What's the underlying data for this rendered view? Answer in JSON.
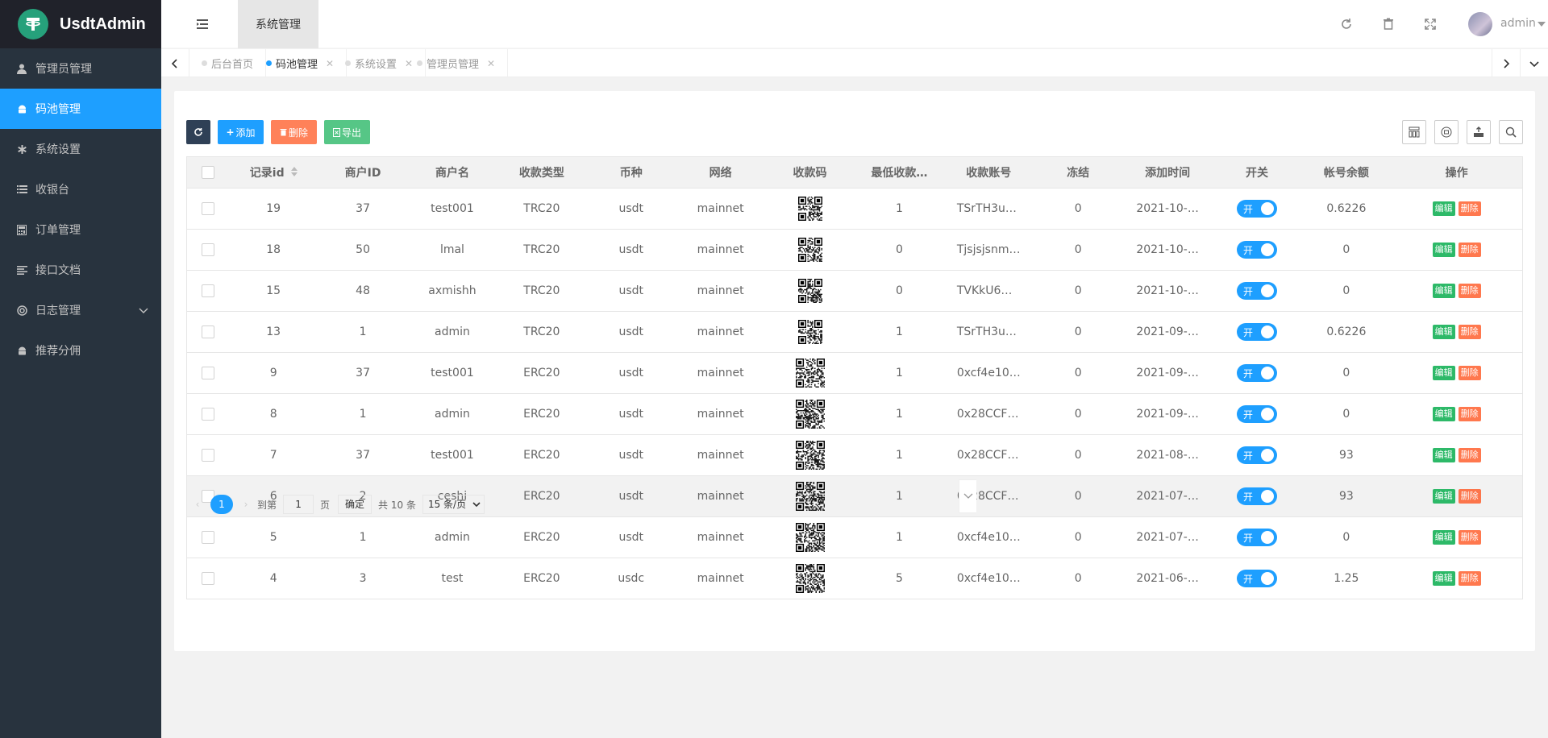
{
  "app": {
    "title": "UsdtAdmin"
  },
  "sidebar": {
    "items": [
      {
        "label": "管理员管理",
        "icon": "user-icon"
      },
      {
        "label": "码池管理",
        "icon": "android-icon",
        "active": true
      },
      {
        "label": "系统设置",
        "icon": "asterisk-icon"
      },
      {
        "label": "收银台",
        "icon": "list-icon"
      },
      {
        "label": "订单管理",
        "icon": "calculator-icon"
      },
      {
        "label": "接口文档",
        "icon": "align-left-icon"
      },
      {
        "label": "日志管理",
        "icon": "life-ring-icon",
        "expandable": true
      },
      {
        "label": "推荐分佣",
        "icon": "android-icon"
      }
    ]
  },
  "header": {
    "top_tab": "系统管理",
    "user": "admin",
    "icons": [
      "refresh-icon",
      "trash-icon",
      "fullscreen-icon"
    ]
  },
  "tabs": [
    {
      "label": "后台首页",
      "closable": false
    },
    {
      "label": "码池管理",
      "closable": true,
      "active": true
    },
    {
      "label": "系统设置",
      "closable": true
    },
    {
      "label": "管理员管理",
      "closable": true
    }
  ],
  "toolbar": {
    "add_label": "添加",
    "delete_label": "删除",
    "export_label": "导出"
  },
  "table": {
    "columns": [
      "记录id",
      "商户ID",
      "商户名",
      "收款类型",
      "币种",
      "网络",
      "收款码",
      "最低收款…",
      "收款账号",
      "冻结",
      "添加时间",
      "开关",
      "帐号余额",
      "操作"
    ],
    "switch_label": "开",
    "edit_label": "编辑",
    "del_label": "删除",
    "rows": [
      {
        "id": "19",
        "mid": "37",
        "mname": "test001",
        "type": "TRC20",
        "coin": "usdt",
        "net": "mainnet",
        "min": "1",
        "addr": "TSrTH3u…",
        "frozen": "0",
        "time": "2021-10-…",
        "balance": "0.6226"
      },
      {
        "id": "18",
        "mid": "50",
        "mname": "lmal",
        "type": "TRC20",
        "coin": "usdt",
        "net": "mainnet",
        "min": "0",
        "addr": "Tjsjsjsnm…",
        "frozen": "0",
        "time": "2021-10-…",
        "balance": "0"
      },
      {
        "id": "15",
        "mid": "48",
        "mname": "axmishh",
        "type": "TRC20",
        "coin": "usdt",
        "net": "mainnet",
        "min": "0",
        "addr": "TVKkU6…",
        "frozen": "0",
        "time": "2021-10-…",
        "balance": "0"
      },
      {
        "id": "13",
        "mid": "1",
        "mname": "admin",
        "type": "TRC20",
        "coin": "usdt",
        "net": "mainnet",
        "min": "1",
        "addr": "TSrTH3u…",
        "frozen": "0",
        "time": "2021-09-…",
        "balance": "0.6226"
      },
      {
        "id": "9",
        "mid": "37",
        "mname": "test001",
        "type": "ERC20",
        "coin": "usdt",
        "net": "mainnet",
        "min": "1",
        "addr": "0xcf4e10…",
        "frozen": "0",
        "time": "2021-09-…",
        "balance": "0"
      },
      {
        "id": "8",
        "mid": "1",
        "mname": "admin",
        "type": "ERC20",
        "coin": "usdt",
        "net": "mainnet",
        "min": "1",
        "addr": "0x28CCF…",
        "frozen": "0",
        "time": "2021-09-…",
        "balance": "0"
      },
      {
        "id": "7",
        "mid": "37",
        "mname": "test001",
        "type": "ERC20",
        "coin": "usdt",
        "net": "mainnet",
        "min": "1",
        "addr": "0x28CCF…",
        "frozen": "0",
        "time": "2021-08-…",
        "balance": "93"
      },
      {
        "id": "6",
        "mid": "2",
        "mname": "ceshi",
        "type": "ERC20",
        "coin": "usdt",
        "net": "mainnet",
        "min": "1",
        "addr": "0x28CCF…",
        "frozen": "0",
        "time": "2021-07-…",
        "balance": "93"
      },
      {
        "id": "5",
        "mid": "1",
        "mname": "admin",
        "type": "ERC20",
        "coin": "usdt",
        "net": "mainnet",
        "min": "1",
        "addr": "0xcf4e10…",
        "frozen": "0",
        "time": "2021-07-…",
        "balance": "0"
      },
      {
        "id": "4",
        "mid": "3",
        "mname": "test",
        "type": "ERC20",
        "coin": "usdc",
        "net": "mainnet",
        "min": "5",
        "addr": "0xcf4e10…",
        "frozen": "0",
        "time": "2021-06-…",
        "balance": "1.25"
      }
    ]
  },
  "pager": {
    "current": "1",
    "goto_prefix": "到第",
    "goto_value": "1",
    "goto_suffix": "页",
    "confirm": "确定",
    "total": "共 10 条",
    "page_size": "15 条/页"
  },
  "colors": {
    "sidebar_bg": "#28333e",
    "logo_bg": "#20222a",
    "accent": "#1e9fff",
    "edit": "#2db968",
    "danger": "#ff5722",
    "brand": "#26a17b"
  }
}
